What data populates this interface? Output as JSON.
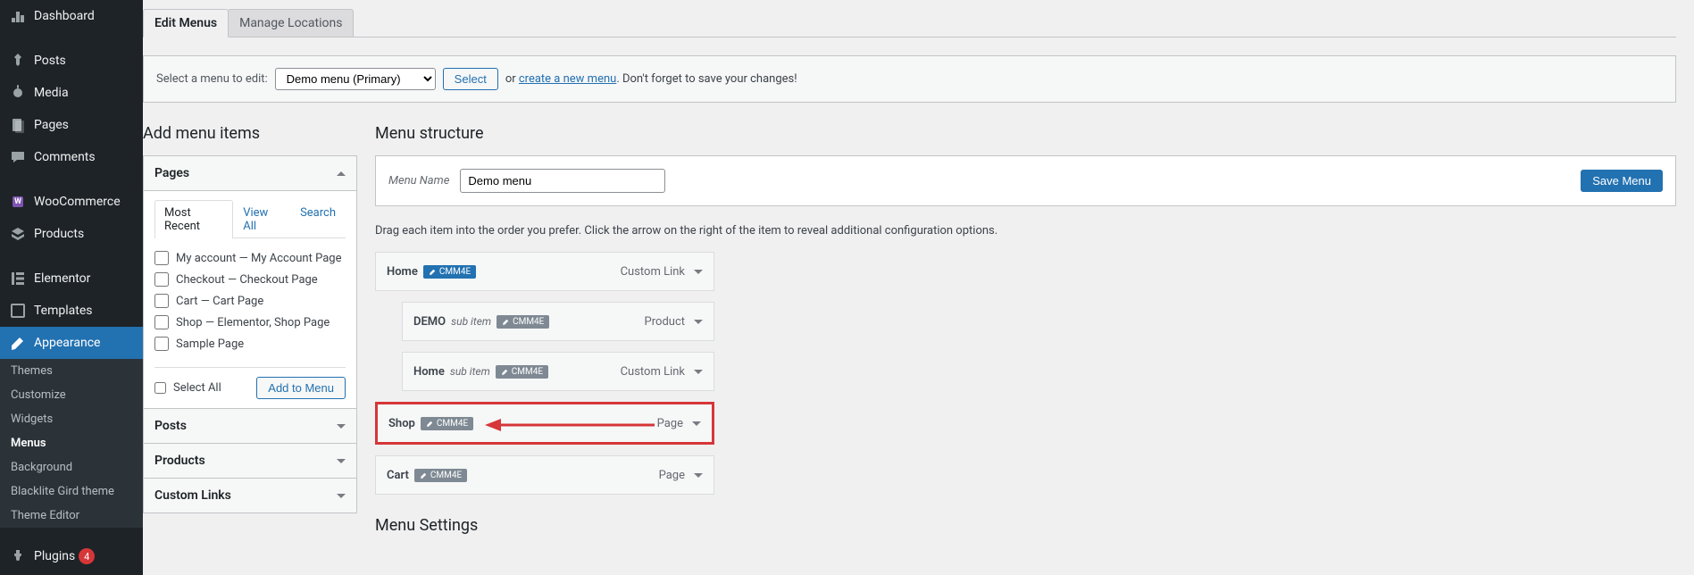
{
  "sidebar": {
    "items": [
      {
        "label": "Dashboard",
        "icon": "dashboard-icon"
      },
      {
        "label": "Posts",
        "icon": "pin-icon"
      },
      {
        "label": "Media",
        "icon": "media-icon"
      },
      {
        "label": "Pages",
        "icon": "pages-icon"
      },
      {
        "label": "Comments",
        "icon": "comments-icon"
      },
      {
        "label": "WooCommerce",
        "icon": "woocommerce-icon"
      },
      {
        "label": "Products",
        "icon": "products-icon"
      },
      {
        "label": "Elementor",
        "icon": "elementor-icon"
      },
      {
        "label": "Templates",
        "icon": "templates-icon"
      },
      {
        "label": "Appearance",
        "icon": "appearance-icon"
      }
    ],
    "appearance_sub": [
      {
        "label": "Themes"
      },
      {
        "label": "Customize"
      },
      {
        "label": "Widgets"
      },
      {
        "label": "Menus"
      },
      {
        "label": "Background"
      },
      {
        "label": "Blacklite Gird theme"
      },
      {
        "label": "Theme Editor"
      }
    ],
    "plugins_label": "Plugins",
    "plugins_count": "4"
  },
  "tabs": {
    "edit": "Edit Menus",
    "locations": "Manage Locations"
  },
  "select_row": {
    "label": "Select a menu to edit:",
    "dropdown_value": "Demo menu (Primary)",
    "select_btn": "Select",
    "or": "or",
    "create_link": "create a new menu",
    "suffix": ". Don't forget to save your changes!"
  },
  "left_panel": {
    "title": "Add menu items",
    "pages_accordion": "Pages",
    "inner_tabs": {
      "recent": "Most Recent",
      "view_all": "View All",
      "search": "Search"
    },
    "page_items": [
      {
        "label": "My account — My Account Page"
      },
      {
        "label": "Checkout — Checkout Page"
      },
      {
        "label": "Cart — Cart Page"
      },
      {
        "label": "Shop — Elementor, Shop Page"
      },
      {
        "label": "Sample Page"
      }
    ],
    "select_all": "Select All",
    "add_to_menu": "Add to Menu",
    "posts_accordion": "Posts",
    "products_accordion": "Products",
    "custom_links_accordion": "Custom Links"
  },
  "right_panel": {
    "title": "Menu structure",
    "menu_name_label": "Menu Name",
    "menu_name_value": "Demo menu",
    "save_btn": "Save Menu",
    "instructions": "Drag each item into the order you prefer. Click the arrow on the right of the item to reveal additional configuration options.",
    "menu_items": [
      {
        "title": "Home",
        "badge_color": "blue",
        "badge_text": "CMM4E",
        "type": "Custom Link",
        "indent": 0,
        "sub": false
      },
      {
        "title": "DEMO",
        "badge_color": "grey",
        "badge_text": "CMM4E",
        "type": "Product",
        "indent": 1,
        "sub": true
      },
      {
        "title": "Home",
        "badge_color": "grey",
        "badge_text": "CMM4E",
        "type": "Custom Link",
        "indent": 1,
        "sub": true
      },
      {
        "title": "Shop",
        "badge_color": "grey",
        "badge_text": "CMM4E",
        "type": "Page",
        "indent": 0,
        "sub": false,
        "highlighted": true
      },
      {
        "title": "Cart",
        "badge_color": "grey",
        "badge_text": "CMM4E",
        "type": "Page",
        "indent": 0,
        "sub": false
      }
    ],
    "sub_item_text": "sub item",
    "settings_title": "Menu Settings"
  }
}
